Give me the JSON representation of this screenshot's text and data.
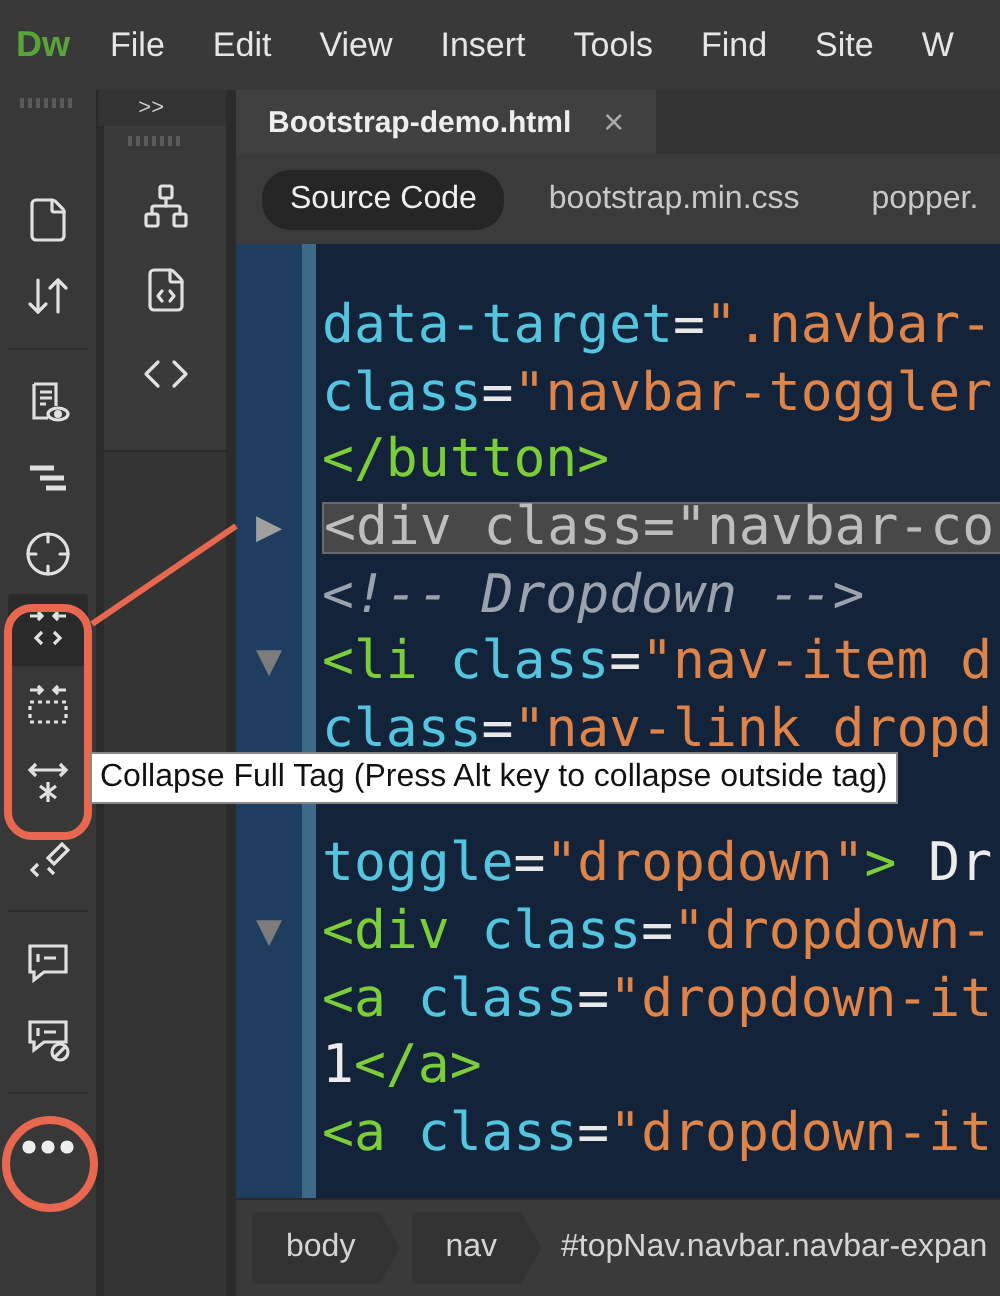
{
  "app_logo": "Dw",
  "menu": [
    {
      "label": "File"
    },
    {
      "label": "Edit"
    },
    {
      "label": "View"
    },
    {
      "label": "Insert"
    },
    {
      "label": "Tools"
    },
    {
      "label": "Find"
    },
    {
      "label": "Site"
    },
    {
      "label": "W"
    }
  ],
  "left_toolbar": [
    {
      "selected": false
    },
    {
      "selected": false
    },
    {
      "selected": false
    },
    {
      "selected": false
    },
    {
      "selected": false
    },
    {
      "selected": true
    },
    {
      "selected": false
    },
    {
      "selected": false
    },
    {
      "selected": false
    },
    {
      "selected": false
    },
    {
      "selected": false
    },
    {
      "selected": false
    }
  ],
  "panel_expand": ">>",
  "document_tabs": [
    {
      "label": "Bootstrap-demo.html",
      "selected": true,
      "close": "×"
    }
  ],
  "related_files": [
    {
      "label": "Source Code",
      "selected": true
    },
    {
      "label": "bootstrap.min.css",
      "selected": false
    },
    {
      "label": "popper.",
      "selected": false
    }
  ],
  "code_lines": [
    {
      "tokens": [
        {
          "kind": "attr",
          "text": "data-target"
        },
        {
          "kind": "punct",
          "text": "="
        },
        {
          "kind": "string",
          "text": "\".navbar-"
        }
      ]
    },
    {
      "tokens": [
        {
          "kind": "attr",
          "text": "class"
        },
        {
          "kind": "punct",
          "text": "="
        },
        {
          "kind": "string",
          "text": "\"navbar-toggler"
        }
      ]
    },
    {
      "tokens": [
        {
          "kind": "tag",
          "text": "</button>"
        }
      ]
    },
    {
      "fold": "▶",
      "tokens": [
        {
          "kind": "folded",
          "text": "<div class=\"navbar-co"
        }
      ]
    },
    {
      "tokens": [
        {
          "kind": "comment",
          "text": "<!-- Dropdown -->"
        }
      ]
    },
    {
      "fold": "▼",
      "tokens": [
        {
          "kind": "tag",
          "text": "<li"
        },
        {
          "kind": "attr",
          "text": " class"
        },
        {
          "kind": "punct",
          "text": "="
        },
        {
          "kind": "string",
          "text": "\"nav-item d"
        }
      ]
    },
    {
      "tokens": [
        {
          "kind": "attr",
          "text": "class"
        },
        {
          "kind": "punct",
          "text": "="
        },
        {
          "kind": "string",
          "text": "\"nav-link dropd"
        }
      ]
    },
    {
      "covered": true
    },
    {
      "tokens": [
        {
          "kind": "attr",
          "text": "toggle"
        },
        {
          "kind": "punct",
          "text": "="
        },
        {
          "kind": "string",
          "text": "\"dropdown\""
        },
        {
          "kind": "tag",
          "text": ">"
        },
        {
          "kind": "text",
          "text": " Dr"
        }
      ]
    },
    {
      "fold": "▼",
      "tokens": [
        {
          "kind": "tag",
          "text": "<div"
        },
        {
          "kind": "attr",
          "text": " class"
        },
        {
          "kind": "punct",
          "text": "="
        },
        {
          "kind": "string",
          "text": "\"dropdown-"
        }
      ]
    },
    {
      "tokens": [
        {
          "kind": "tag",
          "text": "<a"
        },
        {
          "kind": "attr",
          "text": " class"
        },
        {
          "kind": "punct",
          "text": "="
        },
        {
          "kind": "string",
          "text": "\"dropdown-it"
        }
      ]
    },
    {
      "tokens": [
        {
          "kind": "text",
          "text": "1"
        },
        {
          "kind": "tag",
          "text": "</a>"
        }
      ]
    },
    {
      "tokens": [
        {
          "kind": "tag",
          "text": "<a"
        },
        {
          "kind": "attr",
          "text": " class"
        },
        {
          "kind": "punct",
          "text": "="
        },
        {
          "kind": "string",
          "text": "\"dropdown-it"
        }
      ]
    }
  ],
  "breadcrumb": [
    {
      "label": "body"
    },
    {
      "label": "nav"
    }
  ],
  "breadcrumb_selector": "#topNav.navbar.navbar-expan",
  "tooltip": "Collapse Full Tag (Press Alt key to collapse outside tag)"
}
